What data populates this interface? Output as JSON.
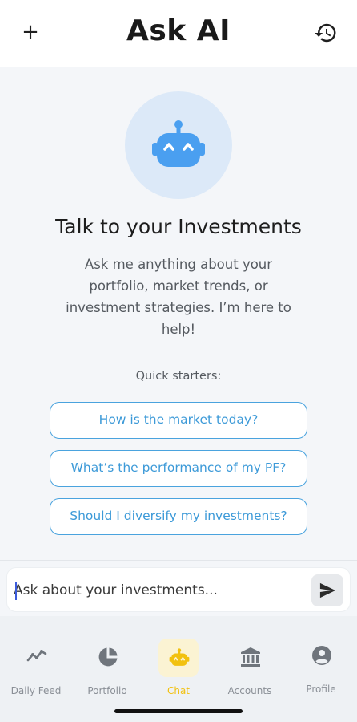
{
  "header": {
    "title": "Ask AI",
    "new_chat_icon": "+"
  },
  "hero": {
    "headline": "Talk to your Investments",
    "description": "Ask me anything about your portfolio, market trends, or investment strategies. I’m here to help!",
    "icon": "robot-icon"
  },
  "quick_starters": {
    "label": "Quick starters:",
    "items": [
      "How is the market today?",
      "What’s the performance of my PF?",
      "Should I diversify my investments?"
    ]
  },
  "composer": {
    "placeholder": "Ask about your investments...",
    "value": ""
  },
  "tabs": [
    {
      "label": "Daily Feed",
      "icon": "trend-line-icon",
      "active": false
    },
    {
      "label": "Portfolio",
      "icon": "pie-chart-icon",
      "active": false
    },
    {
      "label": "Chat",
      "icon": "robot-icon",
      "active": true
    },
    {
      "label": "Accounts",
      "icon": "bank-icon",
      "active": false
    },
    {
      "label": "Profile",
      "icon": "user-circle-icon",
      "active": false
    }
  ],
  "colors": {
    "accent_blue": "#4aa3de",
    "robot_blue": "#4a9ff0",
    "active_tab": "#f2c10f",
    "background": "#f4f6f9"
  }
}
